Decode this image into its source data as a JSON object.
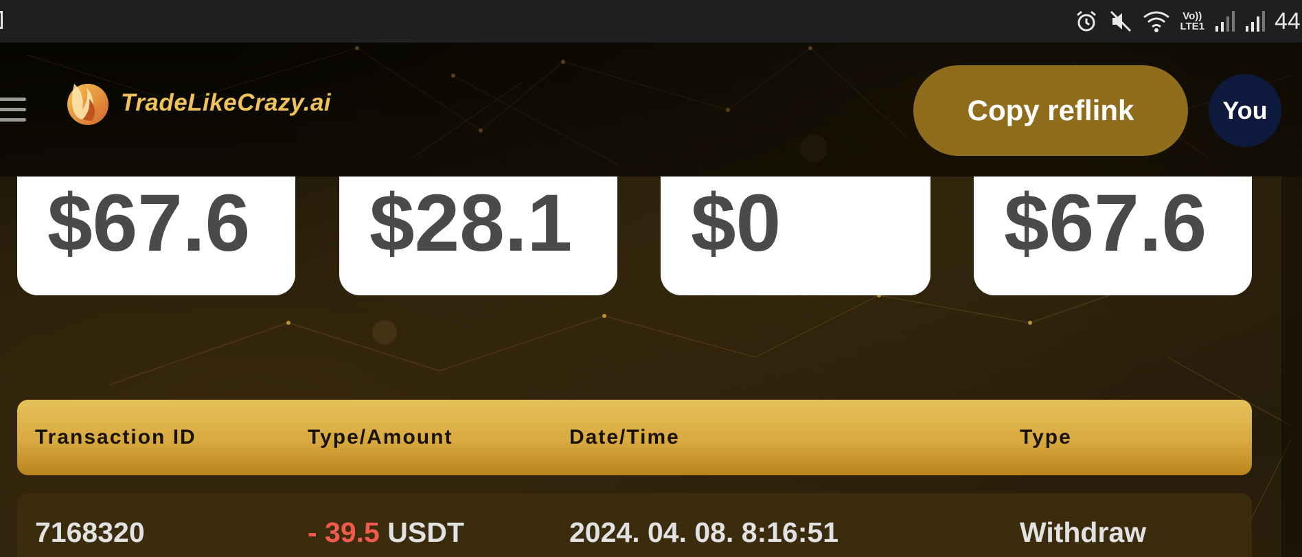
{
  "status_bar": {
    "lte_line1": "Vo))",
    "lte_line2": "LTE1",
    "battery": "44",
    "icons": [
      "alarm-icon",
      "mute-icon",
      "wifi-icon",
      "signal-icon",
      "signal-icon"
    ]
  },
  "header": {
    "brand": "TradeLikeCrazy.ai",
    "copy_button": "Copy reflink",
    "avatar": "You"
  },
  "stats": [
    {
      "value": "$67.6"
    },
    {
      "value": "$28.1"
    },
    {
      "value": "$0"
    },
    {
      "value": "$67.6"
    }
  ],
  "table": {
    "headers": [
      "Transaction ID",
      "Type/Amount",
      "Date/Time",
      "Type"
    ],
    "rows": [
      {
        "id": "7168320",
        "amount_sign": "- 39.5",
        "amount_unit": "USDT",
        "datetime": "2024. 04. 08. 8:16:51",
        "type": "Withdraw"
      }
    ]
  },
  "colors": {
    "accent_gold": "#d7a93e",
    "button_gold": "#8f6d1c",
    "avatar_navy": "#0e1a3d",
    "negative_red": "#f25a4d"
  }
}
